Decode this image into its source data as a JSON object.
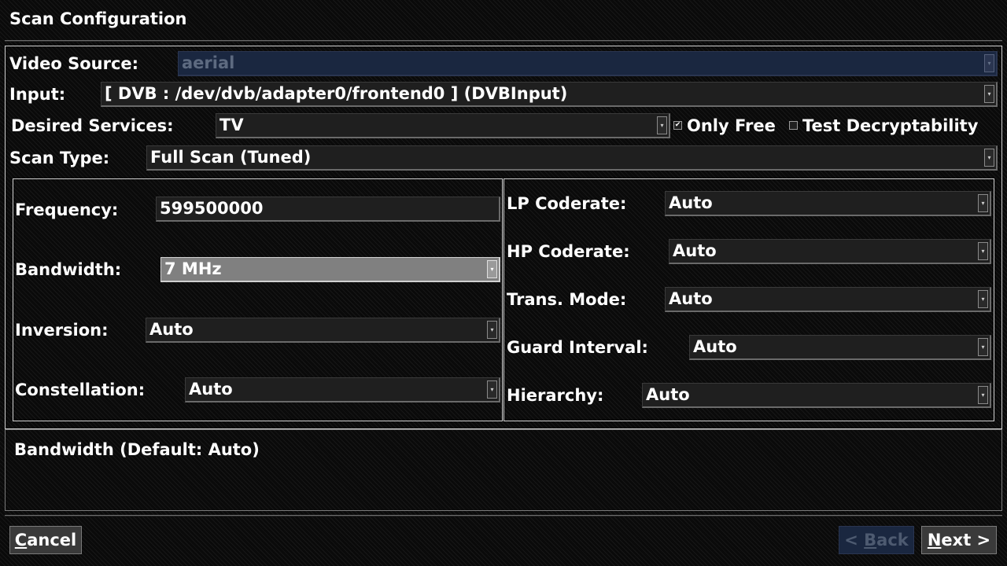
{
  "page": {
    "title": "Scan Configuration"
  },
  "video_source": {
    "label": "Video Source:",
    "value": "aerial"
  },
  "input": {
    "label": "Input:",
    "value": "[ DVB : /dev/dvb/adapter0/frontend0 ] (DVBInput)"
  },
  "desired_services": {
    "label": "Desired Services:",
    "value": "TV",
    "only_free": {
      "label": "Only Free",
      "checked": true,
      "mark": "✔"
    },
    "test_decryptability": {
      "label": "Test Decryptability",
      "checked": false,
      "mark": ""
    }
  },
  "scan_type": {
    "label": "Scan Type:",
    "value": "Full Scan (Tuned)"
  },
  "tuning_left": {
    "frequency": {
      "label": "Frequency:",
      "value": "599500000"
    },
    "bandwidth": {
      "label": "Bandwidth:",
      "value": "7 MHz"
    },
    "inversion": {
      "label": "Inversion:",
      "value": "Auto"
    },
    "constellation": {
      "label": "Constellation:",
      "value": "Auto"
    }
  },
  "tuning_right": {
    "lp_coderate": {
      "label": "LP Coderate:",
      "value": "Auto"
    },
    "hp_coderate": {
      "label": "HP Coderate:",
      "value": "Auto"
    },
    "trans_mode": {
      "label": "Trans. Mode:",
      "value": "Auto"
    },
    "guard_interval": {
      "label": "Guard Interval:",
      "value": "Auto"
    },
    "hierarchy": {
      "label": "Hierarchy:",
      "value": "Auto"
    }
  },
  "help": {
    "text": "Bandwidth (Default: Auto)"
  },
  "buttons": {
    "cancel": {
      "mnemonic": "C",
      "rest": "ancel"
    },
    "back": {
      "prefix": "< ",
      "mnemonic": "B",
      "rest": "ack"
    },
    "next": {
      "mnemonic": "N",
      "rest": "ext >"
    }
  },
  "icons": {
    "dropdown_arrow": "▾"
  },
  "colors": {
    "background": "#0a0a0a",
    "disabled_fill": "#1a2740",
    "focused_fill": "#808080",
    "field_fill": "#1f1f1f"
  }
}
